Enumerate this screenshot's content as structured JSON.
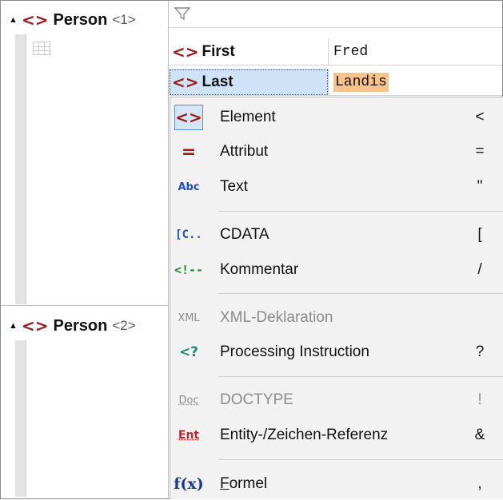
{
  "tree": {
    "person1": {
      "name": "Person",
      "index": "<1>"
    },
    "person2": {
      "name": "Person",
      "index": "<2>"
    },
    "element_glyph": "<>"
  },
  "grid": {
    "rows": [
      {
        "name": "First",
        "value": "Fred"
      },
      {
        "name": "Last",
        "value": "Landis"
      }
    ]
  },
  "context_menu": {
    "items": [
      {
        "icon": "element-icon",
        "icon_text": "<>",
        "label": "Element",
        "shortcut": "<",
        "enabled": true
      },
      {
        "icon": "attribute-icon",
        "icon_text": "=",
        "label": "Attribut",
        "shortcut": "=",
        "enabled": true
      },
      {
        "icon": "text-icon",
        "icon_text": "Abc",
        "label": "Text",
        "shortcut": "\"",
        "enabled": true
      },
      {
        "icon": "cdata-icon",
        "icon_text": "[C..",
        "label": "CDATA",
        "shortcut": "[",
        "enabled": true
      },
      {
        "icon": "comment-icon",
        "icon_text": "<!--",
        "label": "Kommentar",
        "shortcut": "/",
        "enabled": true
      },
      {
        "icon": "xml-declaration-icon",
        "icon_text": "XML",
        "label": "XML-Deklaration",
        "shortcut": "",
        "enabled": false
      },
      {
        "icon": "processing-instruction-icon",
        "icon_text": "<?",
        "label": "Processing Instruction",
        "shortcut": "?",
        "enabled": true
      },
      {
        "icon": "doctype-icon",
        "icon_text": "Doc",
        "label": "DOCTYPE",
        "shortcut": "!",
        "enabled": false
      },
      {
        "icon": "entity-reference-icon",
        "icon_text": "Ent",
        "label": "Entity-/Zeichen-Referenz",
        "shortcut": "&",
        "enabled": true
      },
      {
        "icon": "formula-icon",
        "icon_text": "f(x)",
        "label_first": "F",
        "label_rest": "ormel",
        "shortcut": ",",
        "enabled": true
      }
    ]
  },
  "colors": {
    "element_red": "#9b1b1b",
    "selection_blue": "#cfe3f8",
    "value_highlight": "#f6c48a",
    "menu_bg": "#f2f2f2"
  }
}
